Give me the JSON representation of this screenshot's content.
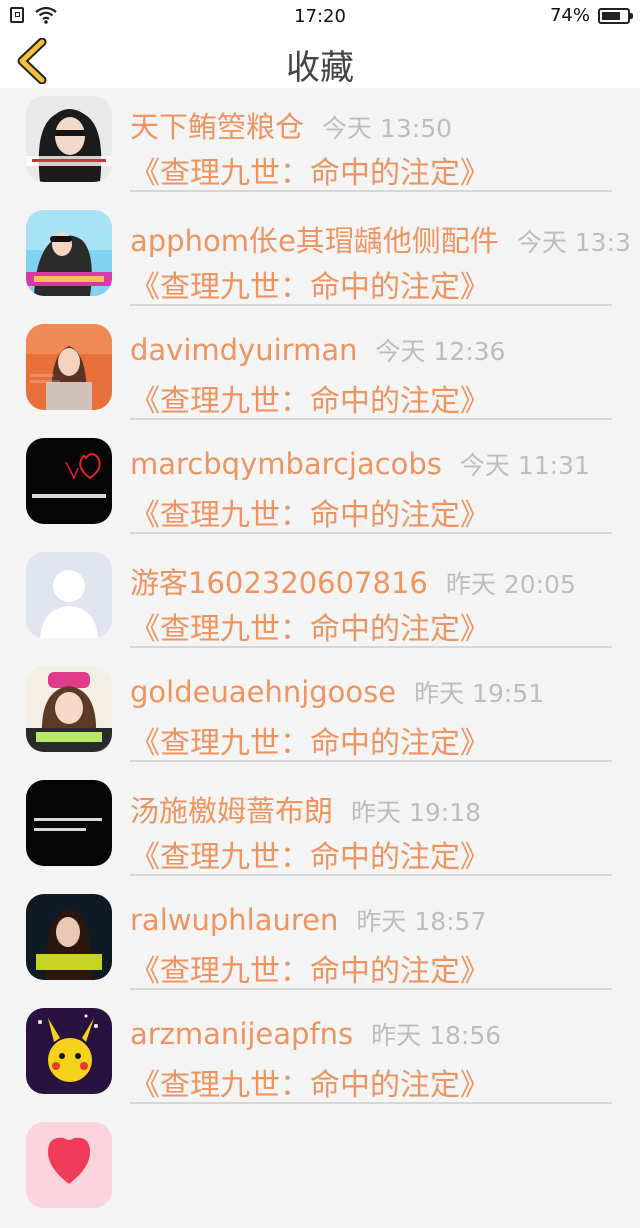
{
  "status": {
    "time": "17:20",
    "battery": "74%",
    "battery_level": 0.74
  },
  "header": {
    "title": "收藏",
    "back_icon": "chevron-left-icon",
    "accent": "#f2c23a"
  },
  "colors": {
    "name": "#ee9460",
    "time": "#bdbdbd",
    "divider": "#d6d6d6",
    "background": "#f4f4f4"
  },
  "items": [
    {
      "name": "天下鲔箜粮仓",
      "time": "今天 13:50",
      "book": "《查理九世：命中的注定》"
    },
    {
      "name": "apphom伥e其瑁龋他侧配件",
      "time": "今天 13:3",
      "book": "《查理九世：命中的注定》"
    },
    {
      "name": "davimdyuirman",
      "time": "今天 12:36",
      "book": "《查理九世：命中的注定》"
    },
    {
      "name": "marcbqymbarcjacobs",
      "time": "今天 11:31",
      "book": "《查理九世：命中的注定》"
    },
    {
      "name": "游客1602320607816",
      "time": "昨天 20:05",
      "book": "《查理九世：命中的注定》"
    },
    {
      "name": "goldeuaehnjgoose",
      "time": "昨天 19:51",
      "book": "《查理九世：命中的注定》"
    },
    {
      "name": "汤施檄姆蔷布朗",
      "time": "昨天 19:18",
      "book": "《查理九世：命中的注定》"
    },
    {
      "name": "ralwuphlauren",
      "time": "昨天 18:57",
      "book": "《查理九世：命中的注定》"
    },
    {
      "name": "arzmanijeapfns",
      "time": "昨天 18:56",
      "book": "《查理九世：命中的注定》"
    }
  ]
}
